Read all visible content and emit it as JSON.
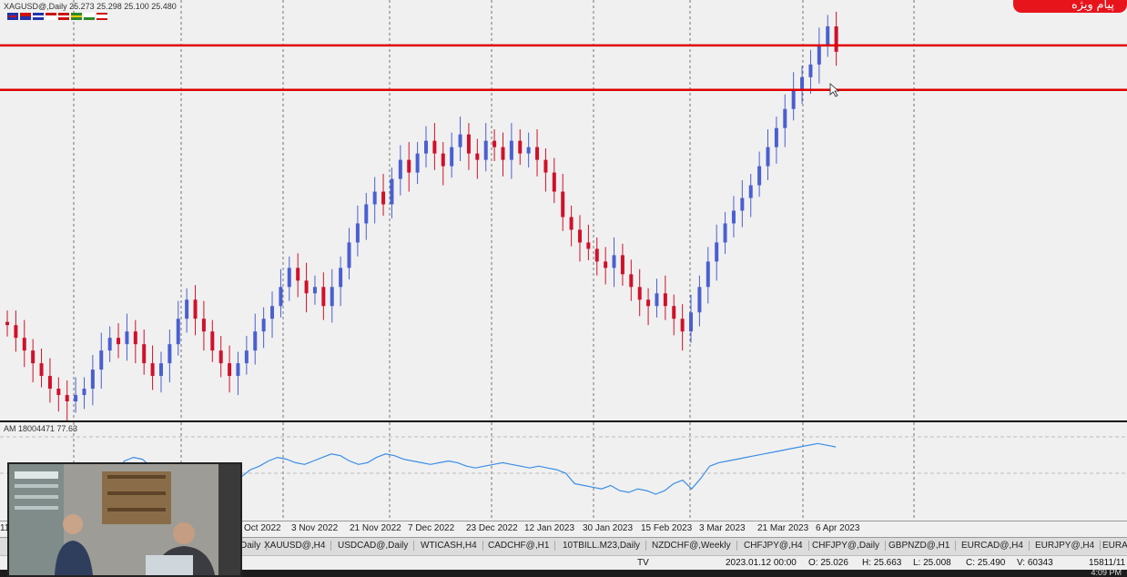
{
  "chart_title": "XAGUSD@,Daily  25.273 25.298 25.100 25.480",
  "indicator_title": "AM 18004471 77.63",
  "badge_text": "پیام ویژه",
  "x_axis_labels": [
    "Oct 2022",
    "3 Nov 2022",
    "21 Nov 2022",
    "7 Dec 2022",
    "23 Dec 2022",
    "12 Jan 2023",
    "30 Jan 2023",
    "15 Feb 2023",
    "3 Mar 2023",
    "21 Mar 2023",
    "6 Apr 2023"
  ],
  "tabs": [
    {
      "label": "Daily"
    },
    {
      "label": "XAUUSD@,H4"
    },
    {
      "label": "USDCAD@,Daily"
    },
    {
      "label": "WTICASH,H4"
    },
    {
      "label": "CADCHF@,H1"
    },
    {
      "label": "10TBILL.M23,Daily"
    },
    {
      "label": "NZDCHF@,Weekly"
    },
    {
      "label": "CHFJPY@,H4"
    },
    {
      "label": "CHFJPY@,Daily"
    },
    {
      "label": "GBPNZD@,H1"
    },
    {
      "label": "EURCAD@,H4"
    },
    {
      "label": "EURJPY@,H4"
    },
    {
      "label": "EURA"
    }
  ],
  "status": {
    "tv": "TV",
    "datetime": "2023.01.12 00:00",
    "open": "O: 25.026",
    "high": "H: 25.663",
    "low": "L: 25.008",
    "close": "C: 25.490",
    "volume": "V: 60343",
    "memory": "15811/11",
    "clock": "4:09 PM"
  },
  "colors": {
    "bull": "#4a5fd0",
    "bear": "#d0102a",
    "level": "#e00000",
    "indicator_line": "#3a8ee6"
  },
  "chart_data": {
    "type": "candlestick",
    "title": "XAGUSD@,Daily",
    "x_labels": [
      "Oct 2022",
      "3 Nov 2022",
      "21 Nov 2022",
      "7 Dec 2022",
      "23 Dec 2022",
      "12 Jan 2023",
      "30 Jan 2023",
      "15 Feb 2023",
      "3 Mar 2023",
      "21 Mar 2023",
      "6 Apr 2023"
    ],
    "ylim": [
      19.5,
      25.9
    ],
    "horizontal_levels": [
      25.3,
      24.6
    ],
    "close_series": [
      20.9,
      20.7,
      20.5,
      20.3,
      20.1,
      19.9,
      19.8,
      19.7,
      19.8,
      19.9,
      20.2,
      20.5,
      20.7,
      20.6,
      20.8,
      20.6,
      20.3,
      20.1,
      20.3,
      20.6,
      21.0,
      21.3,
      21.0,
      20.8,
      20.5,
      20.3,
      20.1,
      20.3,
      20.5,
      20.8,
      21.0,
      21.2,
      21.5,
      21.8,
      21.6,
      21.4,
      21.5,
      21.2,
      21.5,
      21.8,
      22.2,
      22.5,
      22.8,
      23.0,
      22.8,
      23.2,
      23.5,
      23.3,
      23.6,
      23.8,
      23.6,
      23.4,
      23.7,
      23.9,
      23.6,
      23.5,
      23.8,
      23.7,
      23.5,
      23.8,
      23.6,
      23.7,
      23.5,
      23.3,
      23.0,
      22.6,
      22.4,
      22.2,
      22.1,
      21.9,
      21.8,
      22.0,
      21.7,
      21.5,
      21.3,
      21.2,
      21.4,
      21.2,
      21.0,
      20.8,
      21.1,
      21.5,
      21.9,
      22.2,
      22.5,
      22.7,
      22.9,
      23.1,
      23.4,
      23.7,
      24.0,
      24.3,
      24.6,
      24.8,
      25.0,
      25.3,
      25.6,
      25.2
    ],
    "indicator_series": [
      52,
      50,
      48,
      45,
      44,
      46,
      48,
      55,
      60,
      58,
      50,
      48,
      46,
      62,
      66,
      64,
      55,
      50,
      48,
      46,
      44,
      42,
      44,
      48,
      50,
      46,
      44,
      52,
      56,
      62,
      66,
      64,
      60,
      58,
      62,
      66,
      70,
      68,
      62,
      58,
      60,
      66,
      70,
      68,
      64,
      62,
      60,
      58,
      60,
      62,
      60,
      56,
      54,
      56,
      58,
      60,
      58,
      56,
      54,
      56,
      54,
      52,
      48,
      36,
      34,
      32,
      30,
      34,
      28,
      26,
      30,
      28,
      24,
      28,
      36,
      40,
      30,
      42,
      56,
      60,
      62,
      64,
      66,
      68,
      70,
      72,
      74,
      76,
      78,
      80,
      82,
      80,
      78
    ],
    "indicator_ylim": [
      0,
      100
    ]
  }
}
